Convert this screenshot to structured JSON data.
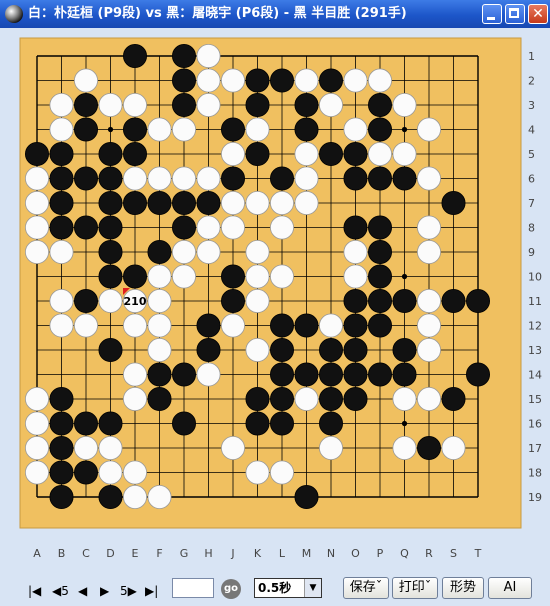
{
  "window": {
    "title": "白：朴廷桓 (P9段) vs 黑：屠晓宇 (P6段) - 黑 半目胜 (291手)",
    "buttons": [
      "min",
      "max",
      "close"
    ],
    "close_label": "✕"
  },
  "board": {
    "size": 19,
    "columns": [
      "A",
      "B",
      "C",
      "D",
      "E",
      "F",
      "G",
      "H",
      "J",
      "K",
      "L",
      "M",
      "N",
      "O",
      "P",
      "Q",
      "R",
      "S",
      "T"
    ],
    "rows": [
      "1",
      "2",
      "3",
      "4",
      "5",
      "6",
      "7",
      "8",
      "9",
      "10",
      "11",
      "12",
      "13",
      "14",
      "15",
      "16",
      "17",
      "18",
      "19"
    ],
    "colors": {
      "wood": "#f0c060",
      "line": "#000000",
      "marker": "#e02020"
    },
    "last_move": {
      "point": "E11",
      "label": "210"
    },
    "stones": [
      "....B.BW...........",
      "..W...BWWBBWBWW....",
      ".WBWW.BW.B.BW.BW...",
      ".WB.BWW.BW.B.WB.W..",
      "BB.BB...WB.WBBWW...",
      "WBBBWWWWB.BW.BBBW..",
      "WB.BBBBBWWWW.....B.",
      "WBBB..BWW.W..BB.W..",
      "WW.B.BWW.W...WB.W..",
      "...BBWW.BWW..WB....",
      ".WBWWW..BW...BBBWBBW",
      ".WW.WW.BW.BBWBB.W..",
      "...B.W.B.WB.BB.BW..",
      "....WBBW..BBBBBB..B",
      "WB..WB...BBWBB.WWB.",
      "WBBB..B..BB.B.....",
      "WBWW....W...W..WBW.",
      "WBBWW....WW.......",
      ".B.BWW.....B......."
    ]
  },
  "toolbar": {
    "nav": [
      "|◀",
      "◀5",
      "◀",
      "▶",
      "5▶",
      "▶|"
    ],
    "go_label": "go",
    "move_input": "",
    "time_value": "0.5秒",
    "select_arrow": "▼",
    "buttons": [
      "保存ˇ",
      "打印ˇ",
      "形势",
      "AI"
    ]
  }
}
